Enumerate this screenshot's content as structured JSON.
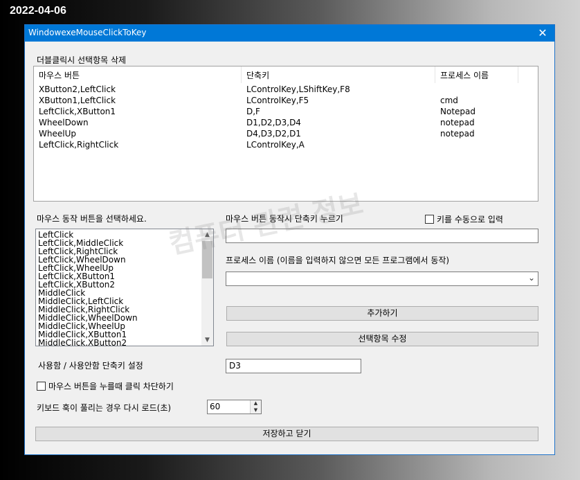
{
  "desktop_date": "2022-04-06",
  "window": {
    "title": "WindowexeMouseClickToKey",
    "close_glyph": "✕"
  },
  "list_section_label": "더블클릭시 선택항목 삭제",
  "listview": {
    "columns": [
      "마우스 버튼",
      "단축키",
      "프로세스 이름"
    ],
    "rows": [
      {
        "buttons": "XButton2,LeftClick",
        "keys": "LControlKey,LShiftKey,F8",
        "process": ""
      },
      {
        "buttons": "XButton1,LeftClick",
        "keys": "LControlKey,F5",
        "process": "cmd"
      },
      {
        "buttons": "LeftClick,XButton1",
        "keys": "D,F",
        "process": "Notepad"
      },
      {
        "buttons": "WheelDown",
        "keys": "D1,D2,D3,D4",
        "process": "notepad"
      },
      {
        "buttons": "WheelUp",
        "keys": "D4,D3,D2,D1",
        "process": "notepad"
      },
      {
        "buttons": "LeftClick,RightClick",
        "keys": "LControlKey,A",
        "process": ""
      }
    ]
  },
  "mouse_action_label": "마우스 동작 버튼을 선택하세요.",
  "mouse_action_list": [
    "LeftClick",
    "LeftClick,MiddleClick",
    "LeftClick,RightClick",
    "LeftClick,WheelDown",
    "LeftClick,WheelUp",
    "LeftClick,XButton1",
    "LeftClick,XButton2",
    "MiddleClick",
    "MiddleClick,LeftClick",
    "MiddleClick,RightClick",
    "MiddleClick,WheelDown",
    "MiddleClick,WheelUp",
    "MiddleClick,XButton1",
    "MiddleClick,XButton2"
  ],
  "shortcut_press_label": "마우스 버튼 동작시 단축키 누르기",
  "manual_key_label": "키를 수동으로 입력",
  "shortcut_value": "",
  "process_label": "프로세스 이름 (이름을 입력하지 않으면 모든 프로그램에서 동작)",
  "process_value": "",
  "add_button": "추가하기",
  "edit_button": "선택항목 수정",
  "toggle_label": "사용함 / 사용안함 단축키 설정",
  "toggle_value": "D3",
  "block_click_label": "마우스 버튼을 누를때 클릭 차단하기",
  "reload_label": "키보드 훅이 풀리는 경우 다시 로드(초)",
  "reload_value": "60",
  "save_button": "저장하고 닫기",
  "watermark": "컴퓨터 관련 정보"
}
